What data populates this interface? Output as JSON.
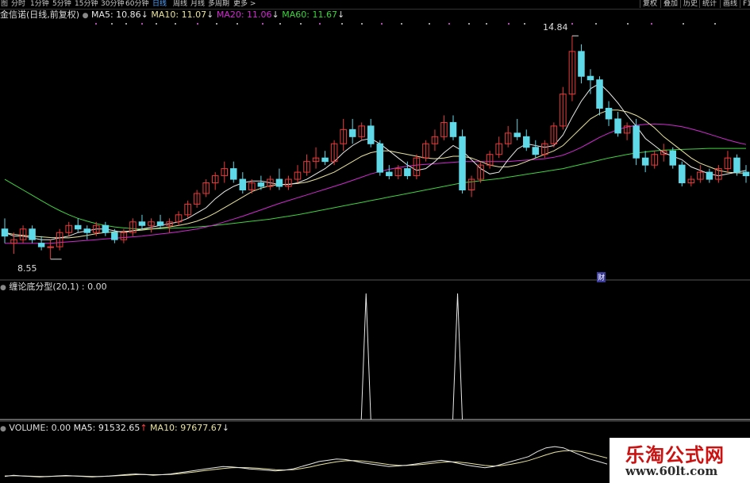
{
  "toolbar": {
    "left_icon": "图",
    "timeframes": [
      "分时",
      "1分钟",
      "5分钟",
      "15分钟",
      "30分钟",
      "60分钟",
      "日线",
      "周线",
      "月线",
      "多周期",
      "更多 >"
    ],
    "active": "日线",
    "right_buttons": [
      "复权",
      "叠加",
      "历史",
      "统计",
      "画线",
      "F1"
    ]
  },
  "legend": {
    "symbol": "金信诺(日线,前复权)",
    "dot": "●",
    "ma5": "MA5: 10.86",
    "ma10": "MA10: 11.07",
    "ma20": "MA20: 11.06",
    "ma60": "MA60: 11.67",
    "down": "↓"
  },
  "indicator": {
    "title": "缠论底分型(20,1) : 0.00",
    "dot": "●"
  },
  "volume": {
    "title": "VOLUME: 0.00",
    "ma5": "MA5: 91532.65",
    "ma10": "MA10: 97677.67",
    "up": "↑",
    "down": "↓",
    "dot": "●"
  },
  "price_labels": {
    "high": "14.84",
    "low": "8.55",
    "fin_marker": "财"
  },
  "watermark": {
    "line1": "乐淘公式网",
    "line2": "www.60lt.com"
  },
  "colors": {
    "up": "#e83a3a",
    "down": "#5fd9e8",
    "ma5": "#e8e8e8",
    "ma10": "#e9e39e",
    "ma20": "#d02ad0",
    "ma60": "#3fd23f"
  },
  "chart_data": {
    "type": "candlestick",
    "ylim": [
      8.3,
      15.0
    ],
    "candles": [
      [
        9.4,
        9.7,
        9.0,
        9.2
      ],
      [
        9.0,
        9.3,
        8.7,
        9.1
      ],
      [
        9.1,
        9.5,
        9.0,
        9.4
      ],
      [
        9.4,
        9.5,
        9.0,
        9.1
      ],
      [
        9.0,
        9.2,
        8.8,
        8.9
      ],
      [
        8.9,
        9.1,
        8.55,
        8.9
      ],
      [
        8.9,
        9.4,
        8.8,
        9.3
      ],
      [
        9.3,
        9.6,
        9.2,
        9.5
      ],
      [
        9.5,
        9.7,
        9.3,
        9.4
      ],
      [
        9.4,
        9.5,
        9.1,
        9.3
      ],
      [
        9.3,
        9.6,
        9.2,
        9.5
      ],
      [
        9.5,
        9.6,
        9.2,
        9.3
      ],
      [
        9.3,
        9.4,
        9.0,
        9.1
      ],
      [
        9.1,
        9.4,
        9.0,
        9.3
      ],
      [
        9.3,
        9.7,
        9.2,
        9.6
      ],
      [
        9.6,
        9.8,
        9.4,
        9.5
      ],
      [
        9.5,
        9.7,
        9.3,
        9.6
      ],
      [
        9.6,
        9.8,
        9.4,
        9.5
      ],
      [
        9.5,
        9.7,
        9.3,
        9.6
      ],
      [
        9.6,
        9.9,
        9.5,
        9.8
      ],
      [
        9.8,
        10.2,
        9.7,
        10.1
      ],
      [
        10.1,
        10.5,
        10.0,
        10.4
      ],
      [
        10.4,
        10.8,
        10.3,
        10.7
      ],
      [
        10.7,
        11.0,
        10.5,
        10.9
      ],
      [
        10.9,
        11.3,
        10.7,
        11.1
      ],
      [
        11.1,
        11.3,
        10.7,
        10.8
      ],
      [
        10.8,
        11.0,
        10.4,
        10.5
      ],
      [
        10.5,
        10.8,
        10.4,
        10.7
      ],
      [
        10.7,
        10.9,
        10.5,
        10.6
      ],
      [
        10.6,
        10.9,
        10.5,
        10.8
      ],
      [
        10.8,
        11.1,
        10.5,
        10.6
      ],
      [
        10.6,
        10.9,
        10.5,
        10.8
      ],
      [
        10.8,
        11.2,
        10.7,
        11.0
      ],
      [
        11.0,
        11.5,
        10.9,
        11.3
      ],
      [
        11.3,
        11.7,
        11.1,
        11.4
      ],
      [
        11.4,
        11.6,
        11.2,
        11.3
      ],
      [
        11.3,
        11.9,
        11.2,
        11.8
      ],
      [
        11.8,
        12.5,
        11.6,
        12.2
      ],
      [
        12.2,
        12.5,
        11.8,
        12.0
      ],
      [
        12.0,
        12.4,
        11.9,
        12.3
      ],
      [
        12.3,
        12.5,
        11.7,
        11.8
      ],
      [
        11.8,
        11.9,
        10.9,
        11.0
      ],
      [
        11.0,
        11.2,
        10.8,
        10.9
      ],
      [
        10.9,
        11.2,
        10.8,
        11.1
      ],
      [
        11.1,
        11.3,
        10.8,
        10.9
      ],
      [
        10.9,
        11.5,
        10.8,
        11.4
      ],
      [
        11.4,
        11.9,
        11.3,
        11.8
      ],
      [
        11.8,
        12.2,
        11.6,
        12.0
      ],
      [
        12.0,
        12.6,
        11.9,
        12.4
      ],
      [
        12.4,
        12.6,
        11.9,
        12.0
      ],
      [
        12.0,
        12.2,
        10.4,
        10.5
      ],
      [
        10.5,
        10.9,
        10.3,
        10.8
      ],
      [
        10.8,
        11.3,
        10.7,
        11.2
      ],
      [
        11.2,
        11.6,
        11.1,
        11.5
      ],
      [
        11.5,
        12.0,
        11.4,
        11.8
      ],
      [
        11.8,
        12.3,
        11.7,
        12.1
      ],
      [
        12.1,
        12.5,
        11.9,
        12.0
      ],
      [
        12.0,
        12.2,
        11.6,
        11.7
      ],
      [
        11.7,
        11.9,
        11.4,
        11.5
      ],
      [
        11.5,
        11.9,
        11.4,
        11.8
      ],
      [
        11.8,
        12.4,
        11.7,
        12.3
      ],
      [
        12.3,
        13.4,
        12.2,
        13.2
      ],
      [
        13.2,
        14.84,
        13.0,
        14.4
      ],
      [
        14.4,
        14.6,
        13.5,
        13.7
      ],
      [
        13.7,
        13.9,
        13.2,
        13.6
      ],
      [
        13.6,
        13.7,
        12.6,
        12.8
      ],
      [
        12.8,
        13.0,
        12.3,
        12.5
      ],
      [
        12.5,
        12.7,
        12.0,
        12.1
      ],
      [
        12.1,
        12.4,
        11.9,
        12.3
      ],
      [
        12.3,
        12.5,
        11.2,
        11.4
      ],
      [
        11.4,
        11.6,
        11.0,
        11.2
      ],
      [
        11.2,
        11.6,
        11.1,
        11.5
      ],
      [
        11.5,
        11.8,
        11.3,
        11.6
      ],
      [
        11.6,
        11.7,
        11.1,
        11.2
      ],
      [
        11.2,
        11.3,
        10.6,
        10.7
      ],
      [
        10.7,
        10.9,
        10.6,
        10.8
      ],
      [
        10.8,
        11.2,
        10.7,
        11.0
      ],
      [
        11.0,
        11.1,
        10.7,
        10.8
      ],
      [
        10.8,
        11.2,
        10.7,
        11.1
      ],
      [
        11.1,
        11.6,
        11.0,
        11.4
      ],
      [
        11.4,
        11.5,
        10.9,
        11.0
      ],
      [
        11.0,
        11.2,
        10.7,
        10.9
      ]
    ],
    "ma5": [
      9.3,
      9.2,
      9.2,
      9.15,
      9.1,
      9.1,
      9.15,
      9.2,
      9.3,
      9.35,
      9.4,
      9.4,
      9.35,
      9.3,
      9.35,
      9.4,
      9.45,
      9.5,
      9.55,
      9.6,
      9.7,
      9.85,
      10.0,
      10.25,
      10.45,
      10.6,
      10.7,
      10.75,
      10.75,
      10.7,
      10.65,
      10.65,
      10.7,
      10.8,
      10.95,
      11.1,
      11.3,
      11.55,
      11.75,
      11.9,
      11.95,
      11.8,
      11.6,
      11.4,
      11.2,
      11.05,
      11.1,
      11.3,
      11.55,
      11.75,
      11.6,
      11.35,
      11.1,
      10.95,
      11.0,
      11.35,
      11.65,
      11.8,
      11.75,
      11.7,
      11.75,
      12.05,
      12.55,
      13.0,
      13.35,
      13.5,
      13.25,
      12.95,
      12.6,
      12.3,
      11.95,
      11.75,
      11.55,
      11.45,
      11.35,
      11.15,
      11.05,
      10.95,
      10.9,
      10.95,
      11.0,
      11.05
    ],
    "ma10": [
      9.3,
      9.25,
      9.22,
      9.2,
      9.18,
      9.16,
      9.15,
      9.15,
      9.18,
      9.22,
      9.27,
      9.3,
      9.32,
      9.33,
      9.35,
      9.37,
      9.4,
      9.43,
      9.46,
      9.5,
      9.55,
      9.62,
      9.72,
      9.85,
      10.0,
      10.15,
      10.3,
      10.45,
      10.55,
      10.62,
      10.65,
      10.66,
      10.68,
      10.72,
      10.8,
      10.9,
      11.0,
      11.15,
      11.3,
      11.45,
      11.55,
      11.6,
      11.6,
      11.55,
      11.5,
      11.45,
      11.4,
      11.38,
      11.4,
      11.45,
      11.45,
      11.4,
      11.3,
      11.2,
      11.15,
      11.15,
      11.2,
      11.3,
      11.4,
      11.5,
      11.6,
      11.75,
      12.0,
      12.25,
      12.5,
      12.65,
      12.75,
      12.75,
      12.7,
      12.6,
      12.45,
      12.25,
      12.0,
      11.8,
      11.6,
      11.4,
      11.25,
      11.15,
      11.05,
      11.0,
      10.98,
      10.97
    ],
    "ma20": [
      9.0,
      9.0,
      9.0,
      9.0,
      9.0,
      9.0,
      9.02,
      9.04,
      9.06,
      9.08,
      9.1,
      9.12,
      9.14,
      9.16,
      9.18,
      9.2,
      9.23,
      9.26,
      9.29,
      9.32,
      9.36,
      9.4,
      9.46,
      9.52,
      9.6,
      9.68,
      9.76,
      9.85,
      9.94,
      10.03,
      10.12,
      10.2,
      10.28,
      10.36,
      10.44,
      10.52,
      10.6,
      10.68,
      10.77,
      10.86,
      10.95,
      11.02,
      11.08,
      11.13,
      11.17,
      11.2,
      11.22,
      11.24,
      11.26,
      11.28,
      11.3,
      11.3,
      11.3,
      11.3,
      11.3,
      11.3,
      11.32,
      11.34,
      11.36,
      11.38,
      11.42,
      11.48,
      11.58,
      11.7,
      11.84,
      11.98,
      12.1,
      12.2,
      12.27,
      12.32,
      12.35,
      12.36,
      12.35,
      12.32,
      12.28,
      12.22,
      12.15,
      12.07,
      11.99,
      11.91,
      11.84,
      11.78
    ],
    "ma60": [
      10.8,
      10.65,
      10.5,
      10.35,
      10.2,
      10.05,
      9.92,
      9.8,
      9.7,
      9.62,
      9.55,
      9.5,
      9.46,
      9.43,
      9.41,
      9.4,
      9.4,
      9.41,
      9.42,
      9.43,
      9.44,
      9.46,
      9.48,
      9.5,
      9.53,
      9.56,
      9.59,
      9.62,
      9.65,
      9.68,
      9.72,
      9.76,
      9.8,
      9.85,
      9.9,
      9.95,
      10.0,
      10.05,
      10.1,
      10.15,
      10.2,
      10.25,
      10.3,
      10.35,
      10.4,
      10.45,
      10.5,
      10.55,
      10.6,
      10.65,
      10.7,
      10.73,
      10.76,
      10.79,
      10.82,
      10.86,
      10.9,
      10.94,
      10.98,
      11.02,
      11.06,
      11.1,
      11.16,
      11.22,
      11.28,
      11.34,
      11.4,
      11.45,
      11.5,
      11.54,
      11.57,
      11.6,
      11.62,
      11.63,
      11.64,
      11.65,
      11.66,
      11.67,
      11.67,
      11.67,
      11.67,
      11.67
    ],
    "indicator": {
      "spikes_at": [
        40,
        50
      ],
      "value": [
        0,
        1
      ]
    },
    "volume_ma5": [
      0.2,
      0.25,
      0.22,
      0.2,
      0.18,
      0.2,
      0.22,
      0.24,
      0.22,
      0.2,
      0.18,
      0.2,
      0.22,
      0.25,
      0.28,
      0.3,
      0.28,
      0.25,
      0.27,
      0.3,
      0.35,
      0.4,
      0.45,
      0.5,
      0.55,
      0.6,
      0.58,
      0.55,
      0.5,
      0.48,
      0.45,
      0.42,
      0.45,
      0.5,
      0.6,
      0.7,
      0.8,
      0.85,
      0.9,
      0.88,
      0.82,
      0.75,
      0.7,
      0.65,
      0.6,
      0.62,
      0.65,
      0.7,
      0.75,
      0.8,
      0.85,
      0.8,
      0.72,
      0.65,
      0.6,
      0.55,
      0.6,
      0.7,
      0.8,
      0.9,
      1.0,
      1.2,
      1.35,
      1.4,
      1.35,
      1.2,
      1.05,
      0.9,
      0.8,
      0.7
    ],
    "volume_ma10": [
      0.22,
      0.23,
      0.22,
      0.21,
      0.2,
      0.2,
      0.21,
      0.22,
      0.22,
      0.21,
      0.2,
      0.2,
      0.21,
      0.23,
      0.25,
      0.27,
      0.28,
      0.27,
      0.27,
      0.28,
      0.31,
      0.35,
      0.39,
      0.44,
      0.48,
      0.52,
      0.55,
      0.56,
      0.55,
      0.53,
      0.5,
      0.47,
      0.46,
      0.47,
      0.52,
      0.58,
      0.66,
      0.73,
      0.79,
      0.83,
      0.84,
      0.82,
      0.78,
      0.73,
      0.68,
      0.65,
      0.64,
      0.66,
      0.69,
      0.73,
      0.77,
      0.79,
      0.78,
      0.74,
      0.69,
      0.64,
      0.62,
      0.64,
      0.69,
      0.76,
      0.84,
      0.95,
      1.07,
      1.17,
      1.23,
      1.24,
      1.2,
      1.12,
      1.03,
      0.94
    ]
  }
}
